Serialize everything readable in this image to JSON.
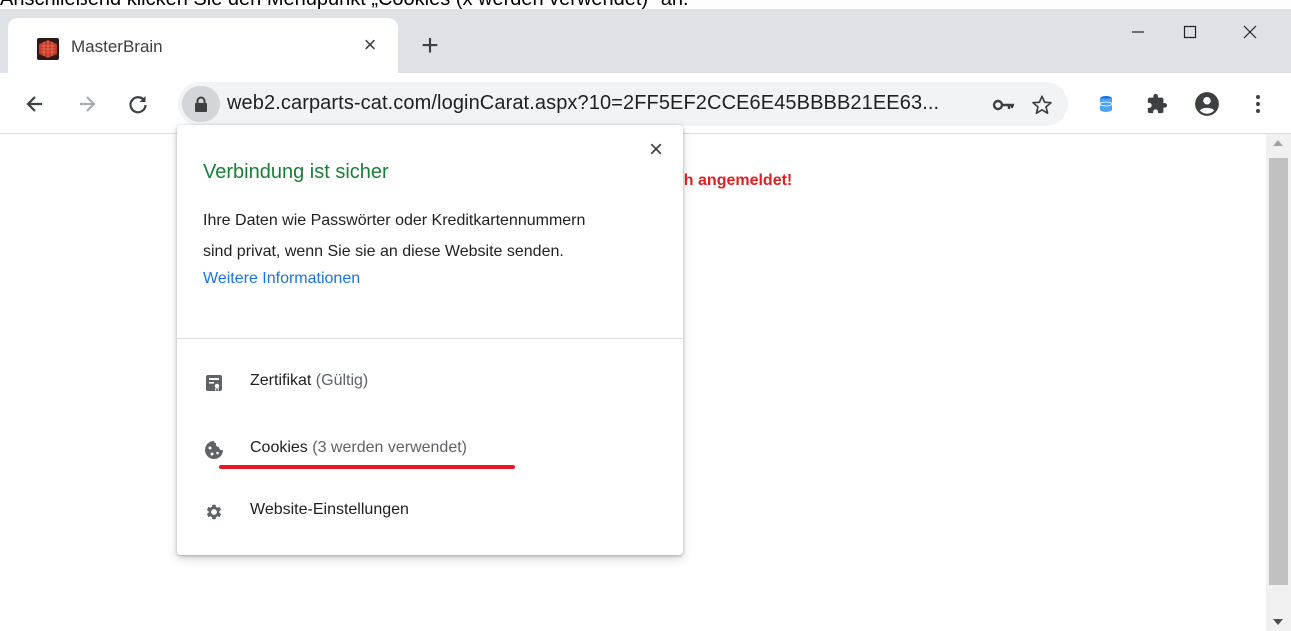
{
  "instruction": "Anschließend klicken Sie den Menüpunkt „Cookies (x werden verwendet)\" an.",
  "tab": {
    "title": "MasterBrain",
    "close_glyph": "×"
  },
  "new_tab_glyph": "+",
  "omnibox": {
    "url": "web2.carparts-cat.com/loginCarat.aspx?10=2FF5EF2CCE6E45BBBB21EE63..."
  },
  "page": {
    "login_message": "sch angemeldet!"
  },
  "popup": {
    "close_glyph": "×",
    "title": "Verbindung ist sicher",
    "desc_line1": "Ihre Daten wie Passwörter oder Kreditkartennummern",
    "desc_line2": "sind privat, wenn Sie sie an diese Website senden.",
    "link": "Weitere Informationen",
    "items": [
      {
        "label": "Zertifikat",
        "sub": " (Gültig)",
        "icon": "certificate-icon"
      },
      {
        "label": "Cookies",
        "sub": " (3 werden verwendet)",
        "icon": "cookie-icon"
      },
      {
        "label": "Website-Einstellungen",
        "sub": "",
        "icon": "gear-icon"
      }
    ]
  },
  "colors": {
    "secure_green": "#188038",
    "link_blue": "#1a73e8",
    "highlight_red": "#e51b23",
    "login_red": "#e02020"
  }
}
